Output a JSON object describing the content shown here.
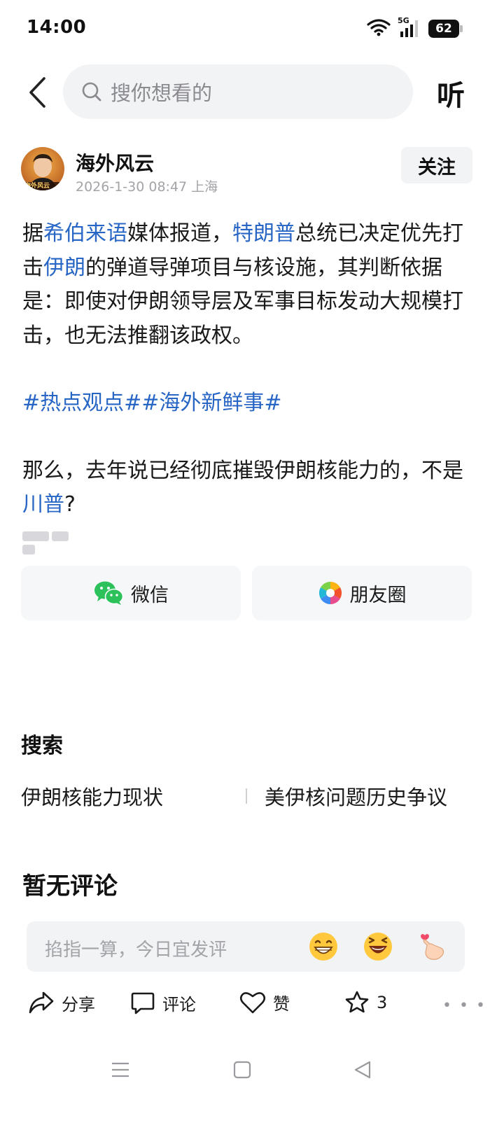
{
  "status_bar": {
    "time": "14:00",
    "network": "5G",
    "battery": "62",
    "icons": [
      "wifi-icon",
      "signal-icon",
      "battery-icon"
    ]
  },
  "top_bar": {
    "search_placeholder": "搜你想看的",
    "listen_label": "听"
  },
  "author": {
    "name": "海外风云",
    "meta": "2026-1-30 08:47 上海",
    "follow_label": "关注",
    "avatar_text": "海外风云"
  },
  "article": {
    "p1": [
      {
        "text": "据",
        "link": false
      },
      {
        "text": "希伯来语",
        "link": true
      },
      {
        "text": "媒体报道，",
        "link": false
      },
      {
        "text": "特朗普",
        "link": true
      },
      {
        "text": "总统已决定优先打击",
        "link": false
      },
      {
        "text": "伊朗",
        "link": true
      },
      {
        "text": "的弹道导弹项目与核设施，其判断依据是：即使对伊朗领导层及军事目标发动大规模打击，也无法推翻该政权。",
        "link": false
      }
    ],
    "tags": "#热点观点##海外新鲜事#",
    "p2": [
      {
        "text": "那么，去年说已经彻底摧毁伊朗核能力的，不是",
        "link": false
      },
      {
        "text": "川普",
        "link": true
      },
      {
        "text": "?",
        "link": false
      }
    ]
  },
  "share": {
    "wechat_label": "微信",
    "moments_label": "朋友圈"
  },
  "search_section": {
    "title": "搜索",
    "suggestions": [
      "伊朗核能力现状",
      "美伊核问题历史争议"
    ]
  },
  "comments": {
    "title": "暂无评论",
    "placeholder": "掐指一算，今日宜发评",
    "emojis": [
      "grin-emoji",
      "laugh-emoji",
      "finger-heart-emoji"
    ]
  },
  "actions": {
    "share_label": "分享",
    "comment_label": "评论",
    "like_label": "赞",
    "favorite_count": "3"
  },
  "colors": {
    "link": "#2866c5",
    "background": "#ffffff",
    "panel": "#f2f3f5"
  }
}
